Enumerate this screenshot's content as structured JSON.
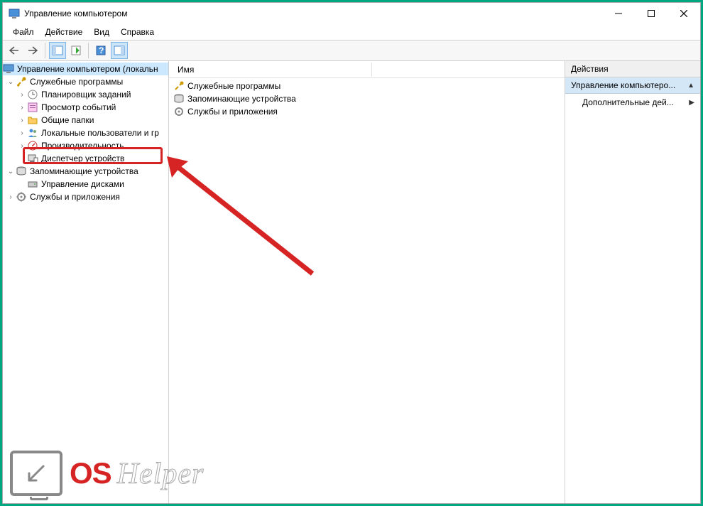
{
  "window": {
    "title": "Управление компьютером"
  },
  "menu": {
    "file": "Файл",
    "action": "Действие",
    "view": "Вид",
    "help": "Справка"
  },
  "tree": {
    "root": "Управление компьютером (локальн",
    "group_util": "Служебные программы",
    "scheduler": "Планировщик заданий",
    "eventviewer": "Просмотр событий",
    "shared": "Общие папки",
    "users": "Локальные пользователи и гр",
    "perf": "Производительность",
    "devmgr": "Диспетчер устройств",
    "group_storage": "Запоминающие устройства",
    "diskmgr": "Управление дисками",
    "group_services": "Службы и приложения"
  },
  "list": {
    "col_name": "Имя",
    "item_util": "Служебные программы",
    "item_storage": "Запоминающие устройства",
    "item_services": "Службы и приложения"
  },
  "actions": {
    "header": "Действия",
    "section": "Управление компьютеро...",
    "more": "Дополнительные дей..."
  },
  "watermark": {
    "os": "OS",
    "helper": "Helper"
  }
}
